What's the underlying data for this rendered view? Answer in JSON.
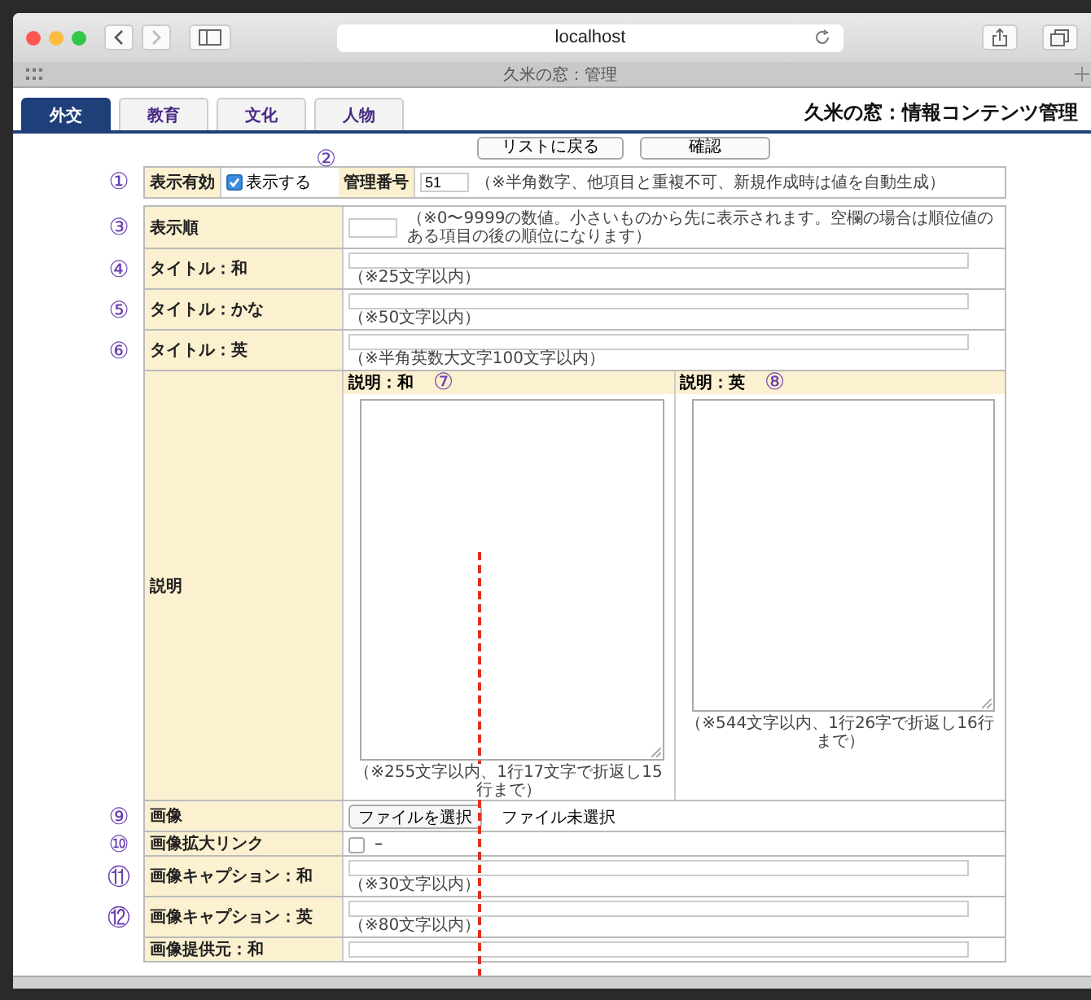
{
  "browser": {
    "address": "localhost",
    "tab_title": "久米の窓：管理"
  },
  "tabs": [
    {
      "label": "外交",
      "selected": true
    },
    {
      "label": "教育",
      "selected": false
    },
    {
      "label": "文化",
      "selected": false
    },
    {
      "label": "人物",
      "selected": false
    }
  ],
  "page_title": "久米の窓：情報コンテンツ管理",
  "actions": [
    "リストに戻る",
    "確認"
  ],
  "rows": [
    {
      "kind": "visibility",
      "marker": "①",
      "label": "表示有効",
      "checked": true,
      "check_label": "表示する",
      "marker2": "②",
      "label2": "管理番号",
      "value": "51",
      "note": "（※半角数字、他項目と重複不可、新規作成時は値を自動生成）"
    },
    {
      "kind": "number",
      "marker": "③",
      "label": "表示順",
      "note": "（※0〜9999の数値。小さいものから先に表示されます。空欄の場合は順位値のある項目の後の順位になります）"
    },
    {
      "kind": "text",
      "marker": "④",
      "label": "タイトル：和",
      "note": "（※25文字以内）"
    },
    {
      "kind": "text",
      "marker": "⑤",
      "label": "タイトル：かな",
      "note": "（※50文字以内）"
    },
    {
      "kind": "text",
      "marker": "⑥",
      "label": "タイトル：英",
      "note": "（※半角英数大文字100文字以内）"
    },
    {
      "kind": "description",
      "label": "説明",
      "columns": [
        {
          "header": "説明：和",
          "marker": "⑦",
          "note": "（※255文字以内、1行17文字で折返し15行まで）"
        },
        {
          "header": "説明：英",
          "marker": "⑧",
          "note": "（※544文字以内、1行26字で折返し16行まで）"
        }
      ]
    },
    {
      "kind": "file",
      "marker": "⑨",
      "label": "画像",
      "button": "ファイルを選択",
      "status": "ファイル未選択"
    },
    {
      "kind": "checkbox",
      "marker": "⑩",
      "label": "画像拡大リンク",
      "checked": false,
      "text": "–"
    },
    {
      "kind": "text",
      "marker": "⑪",
      "label": "画像キャプション：和",
      "note": "（※30文字以内）"
    },
    {
      "kind": "text",
      "marker": "⑫",
      "label": "画像キャプション：英",
      "note": "（※80文字以内）"
    },
    {
      "kind": "text",
      "label": "画像提供元：和"
    }
  ]
}
